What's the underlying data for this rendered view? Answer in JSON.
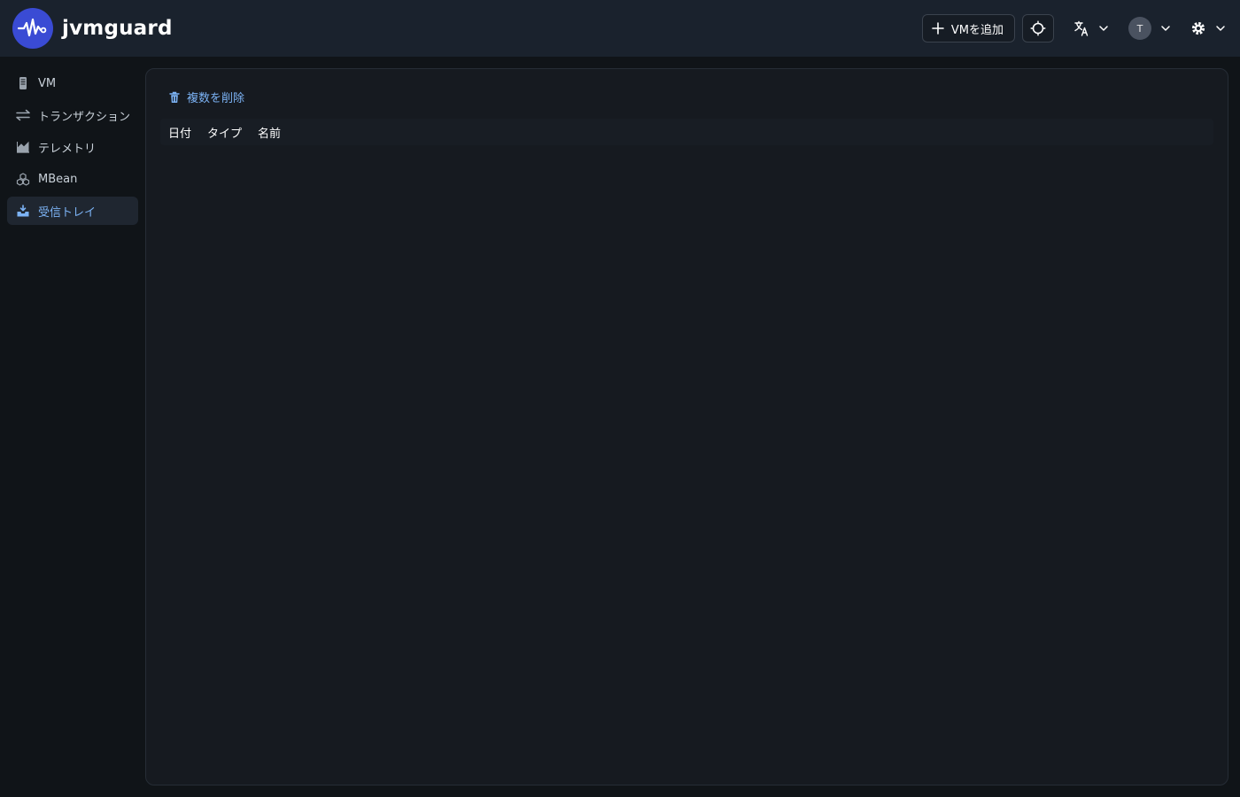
{
  "app": {
    "name": "jvmguard"
  },
  "header": {
    "add_vm_label": "VMを追加",
    "avatar_initial": "T"
  },
  "sidebar": {
    "items": [
      {
        "label": "VM",
        "icon": "server-icon"
      },
      {
        "label": "トランザクション",
        "icon": "transfer-icon"
      },
      {
        "label": "テレメトリ",
        "icon": "area-chart-icon"
      },
      {
        "label": "MBean",
        "icon": "cubes-icon"
      },
      {
        "label": "受信トレイ",
        "icon": "inbox-icon",
        "active": true
      }
    ]
  },
  "main": {
    "delete_multiple_label": "複数を削除",
    "columns": [
      "日付",
      "タイプ",
      "名前"
    ]
  },
  "colors": {
    "accent": "#7cb3f5",
    "logo": "#3a4bd4",
    "header_bg": "#1a222d",
    "panel_bg": "#161a20"
  }
}
